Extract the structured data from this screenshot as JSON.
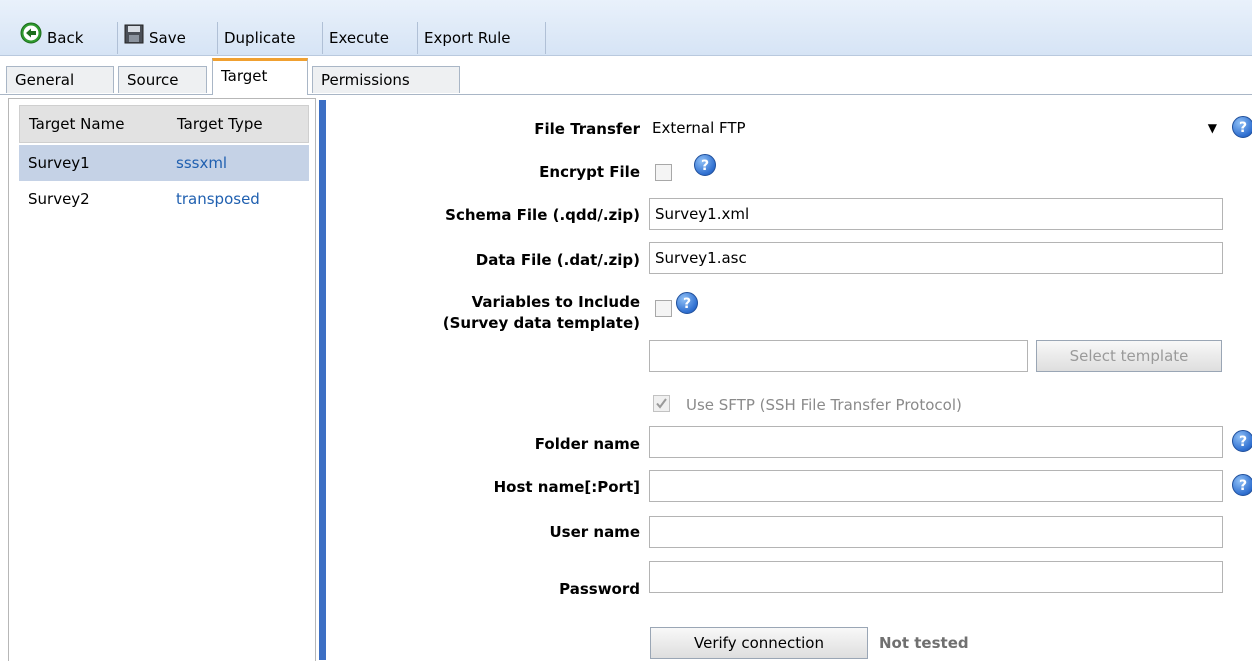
{
  "toolbar": {
    "back_label": "Back",
    "save_label": "Save",
    "duplicate_label": "Duplicate",
    "execute_label": "Execute",
    "export_label": "Export Rule"
  },
  "tabs": [
    {
      "label": "General"
    },
    {
      "label": "Source"
    },
    {
      "label": "Target",
      "active": true
    },
    {
      "label": "Permissions"
    }
  ],
  "targets": {
    "headers": [
      "Target Name",
      "Target Type"
    ],
    "rows": [
      {
        "name": "Survey1",
        "type": "sssxml",
        "selected": true
      },
      {
        "name": "Survey2",
        "type": "transposed",
        "selected": false
      }
    ]
  },
  "form": {
    "file_transfer_label": "File Transfer",
    "file_transfer_value": "External FTP",
    "encrypt_label": "Encrypt File",
    "encrypt_checked": false,
    "schema_label": "Schema File (.qdd/.zip)",
    "schema_value": "Survey1.xml",
    "data_label": "Data File (.dat/.zip)",
    "data_value": "Survey1.asc",
    "variables_label_1": "Variables to Include",
    "variables_label_2": "(Survey data template)",
    "variables_checked": false,
    "template_value": "",
    "select_template_label": "Select template",
    "sftp_label": "Use SFTP (SSH File Transfer Protocol)",
    "sftp_checked": true,
    "folder_label": "Folder name",
    "folder_value": "",
    "host_label": "Host name[:Port]",
    "host_value": "",
    "user_label": "User name",
    "user_value": "",
    "password_label": "Password",
    "password_value": "",
    "verify_label": "Verify connection",
    "status_text": "Not tested"
  },
  "colors": {
    "accent_tab": "#f0a030",
    "divider": "#3c6fc4",
    "selected_row": "#c5d2e6",
    "link_type": "#2060b0"
  },
  "icons": {
    "back": "back-arrow-icon",
    "save": "floppy-disk-icon",
    "help": "help-question-icon",
    "dropdown": "chevron-down-icon"
  }
}
